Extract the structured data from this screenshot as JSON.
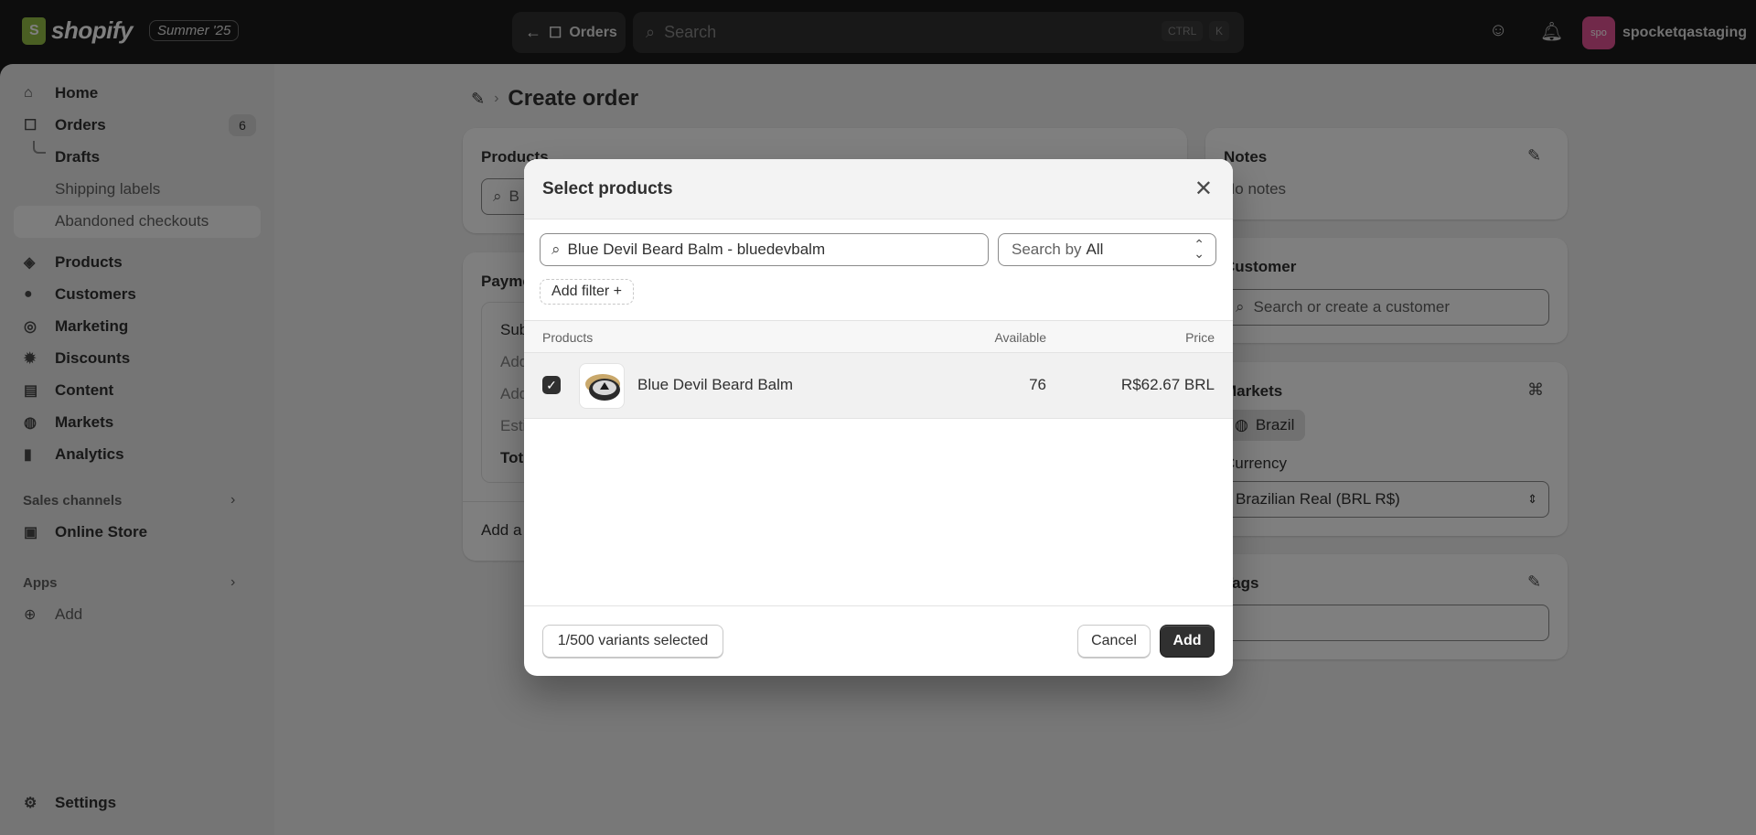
{
  "topbar": {
    "logo_text": "shopify",
    "edition": "Summer '25",
    "back_label": "Orders",
    "search_placeholder": "Search",
    "kbd_ctrl": "CTRL",
    "kbd_k": "K",
    "store_initials": "spo",
    "store_name": "spocketqastaging"
  },
  "sidebar": {
    "home": "Home",
    "orders": "Orders",
    "orders_count": "6",
    "drafts": "Drafts",
    "shipping_labels": "Shipping labels",
    "abandoned_checkouts": "Abandoned checkouts",
    "products": "Products",
    "customers": "Customers",
    "marketing": "Marketing",
    "discounts": "Discounts",
    "content": "Content",
    "markets": "Markets",
    "analytics": "Analytics",
    "sales_channels": "Sales channels",
    "online_store": "Online Store",
    "apps": "Apps",
    "add": "Add",
    "settings": "Settings"
  },
  "page": {
    "title": "Create order",
    "products_card_title": "Products",
    "products_search_partial": "B",
    "payment_title_partial": "Payme",
    "payment_rows_partial": [
      "Sub",
      "Add",
      "Add",
      "Esti",
      "Tot"
    ],
    "add_note_partial": "Add a",
    "notes_title": "Notes",
    "notes_value": "No notes",
    "customer_title": "Customer",
    "customer_placeholder": "Search or create a customer",
    "markets_title": "Markets",
    "market_badge": "Brazil",
    "currency_label": "Currency",
    "currency_value": "Brazilian Real (BRL R$)",
    "tags_title": "Tags"
  },
  "modal": {
    "title": "Select products",
    "search_value": "Blue Devil Beard Balm - bluedevbalm",
    "search_by_label": "Search by",
    "search_by_value": "All",
    "add_filter": "Add filter +",
    "col_products": "Products",
    "col_available": "Available",
    "col_price": "Price",
    "rows": [
      {
        "name": "Blue Devil Beard Balm",
        "available": "76",
        "price": "R$62.67 BRL",
        "checked": true
      }
    ],
    "selected_count": "1/500 variants selected",
    "cancel": "Cancel",
    "add": "Add"
  }
}
